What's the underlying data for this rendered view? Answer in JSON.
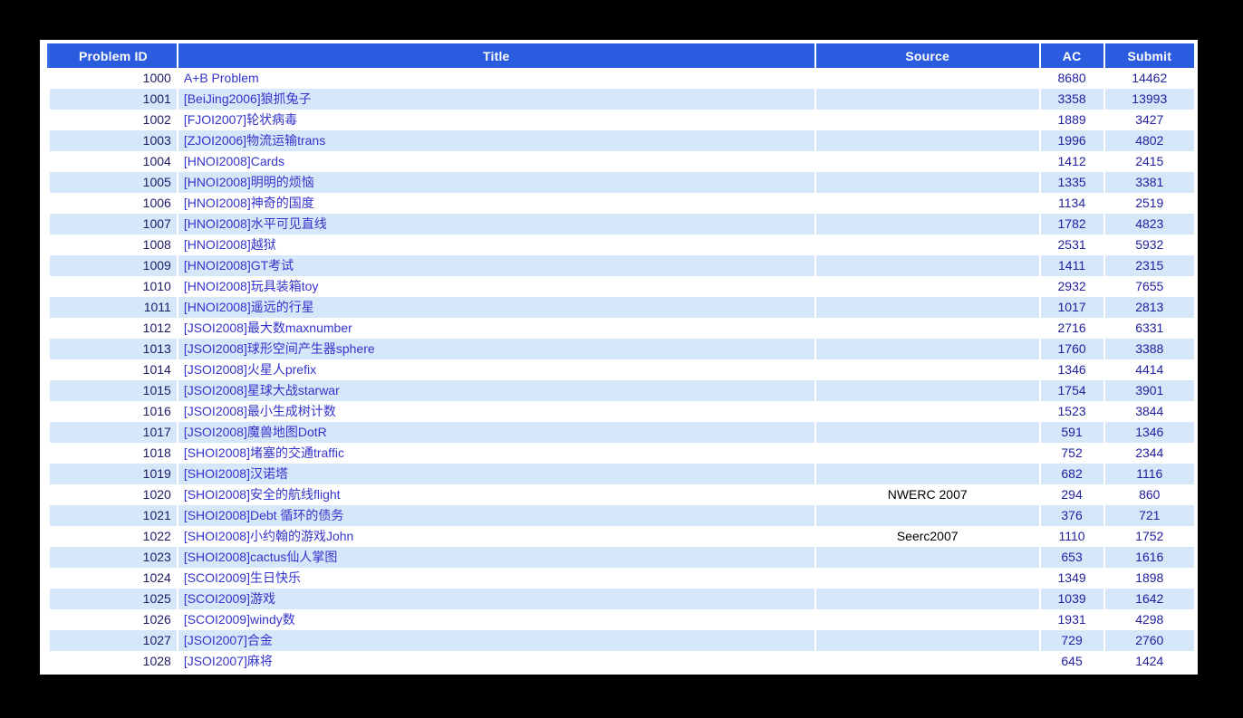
{
  "table": {
    "columns": [
      {
        "key": "problem_id",
        "label": "Problem ID"
      },
      {
        "key": "title",
        "label": "Title"
      },
      {
        "key": "source",
        "label": "Source"
      },
      {
        "key": "ac",
        "label": "AC"
      },
      {
        "key": "submit",
        "label": "Submit"
      }
    ],
    "colors": {
      "header_bg": "#2b5ce0",
      "header_text": "#ffffff",
      "row_even_bg": "#ffffff",
      "row_odd_bg": "#d6e7fa",
      "link": "#3333cc",
      "id_text": "#1a1a66",
      "count_text": "#2020a0",
      "page_bg": "#000000",
      "panel_bg": "#ffffff"
    },
    "rows": [
      {
        "problem_id": "1000",
        "title": "A+B Problem",
        "source": "",
        "ac": "8680",
        "submit": "14462"
      },
      {
        "problem_id": "1001",
        "title": "[BeiJing2006]狼抓兔子",
        "source": "",
        "ac": "3358",
        "submit": "13993"
      },
      {
        "problem_id": "1002",
        "title": "[FJOI2007]轮状病毒",
        "source": "",
        "ac": "1889",
        "submit": "3427"
      },
      {
        "problem_id": "1003",
        "title": "[ZJOI2006]物流运输trans",
        "source": "",
        "ac": "1996",
        "submit": "4802"
      },
      {
        "problem_id": "1004",
        "title": "[HNOI2008]Cards",
        "source": "",
        "ac": "1412",
        "submit": "2415"
      },
      {
        "problem_id": "1005",
        "title": "[HNOI2008]明明的烦恼",
        "source": "",
        "ac": "1335",
        "submit": "3381"
      },
      {
        "problem_id": "1006",
        "title": "[HNOI2008]神奇的国度",
        "source": "",
        "ac": "1134",
        "submit": "2519"
      },
      {
        "problem_id": "1007",
        "title": "[HNOI2008]水平可见直线",
        "source": "",
        "ac": "1782",
        "submit": "4823"
      },
      {
        "problem_id": "1008",
        "title": "[HNOI2008]越狱",
        "source": "",
        "ac": "2531",
        "submit": "5932"
      },
      {
        "problem_id": "1009",
        "title": "[HNOI2008]GT考试",
        "source": "",
        "ac": "1411",
        "submit": "2315"
      },
      {
        "problem_id": "1010",
        "title": "[HNOI2008]玩具装箱toy",
        "source": "",
        "ac": "2932",
        "submit": "7655"
      },
      {
        "problem_id": "1011",
        "title": "[HNOI2008]遥远的行星",
        "source": "",
        "ac": "1017",
        "submit": "2813"
      },
      {
        "problem_id": "1012",
        "title": "[JSOI2008]最大数maxnumber",
        "source": "",
        "ac": "2716",
        "submit": "6331"
      },
      {
        "problem_id": "1013",
        "title": "[JSOI2008]球形空间产生器sphere",
        "source": "",
        "ac": "1760",
        "submit": "3388"
      },
      {
        "problem_id": "1014",
        "title": "[JSOI2008]火星人prefix",
        "source": "",
        "ac": "1346",
        "submit": "4414"
      },
      {
        "problem_id": "1015",
        "title": "[JSOI2008]星球大战starwar",
        "source": "",
        "ac": "1754",
        "submit": "3901"
      },
      {
        "problem_id": "1016",
        "title": "[JSOI2008]最小生成树计数",
        "source": "",
        "ac": "1523",
        "submit": "3844"
      },
      {
        "problem_id": "1017",
        "title": "[JSOI2008]魔兽地图DotR",
        "source": "",
        "ac": "591",
        "submit": "1346"
      },
      {
        "problem_id": "1018",
        "title": "[SHOI2008]堵塞的交通traffic",
        "source": "",
        "ac": "752",
        "submit": "2344"
      },
      {
        "problem_id": "1019",
        "title": "[SHOI2008]汉诺塔",
        "source": "",
        "ac": "682",
        "submit": "1116"
      },
      {
        "problem_id": "1020",
        "title": "[SHOI2008]安全的航线flight",
        "source": "NWERC 2007",
        "ac": "294",
        "submit": "860"
      },
      {
        "problem_id": "1021",
        "title": "[SHOI2008]Debt 循环的债务",
        "source": "",
        "ac": "376",
        "submit": "721"
      },
      {
        "problem_id": "1022",
        "title": "[SHOI2008]小约翰的游戏John",
        "source": "Seerc2007",
        "ac": "1110",
        "submit": "1752"
      },
      {
        "problem_id": "1023",
        "title": "[SHOI2008]cactus仙人掌图",
        "source": "",
        "ac": "653",
        "submit": "1616"
      },
      {
        "problem_id": "1024",
        "title": "[SCOI2009]生日快乐",
        "source": "",
        "ac": "1349",
        "submit": "1898"
      },
      {
        "problem_id": "1025",
        "title": "[SCOI2009]游戏",
        "source": "",
        "ac": "1039",
        "submit": "1642"
      },
      {
        "problem_id": "1026",
        "title": "[SCOI2009]windy数",
        "source": "",
        "ac": "1931",
        "submit": "4298"
      },
      {
        "problem_id": "1027",
        "title": "[JSOI2007]合金",
        "source": "",
        "ac": "729",
        "submit": "2760"
      },
      {
        "problem_id": "1028",
        "title": "[JSOI2007]麻将",
        "source": "",
        "ac": "645",
        "submit": "1424"
      }
    ]
  }
}
